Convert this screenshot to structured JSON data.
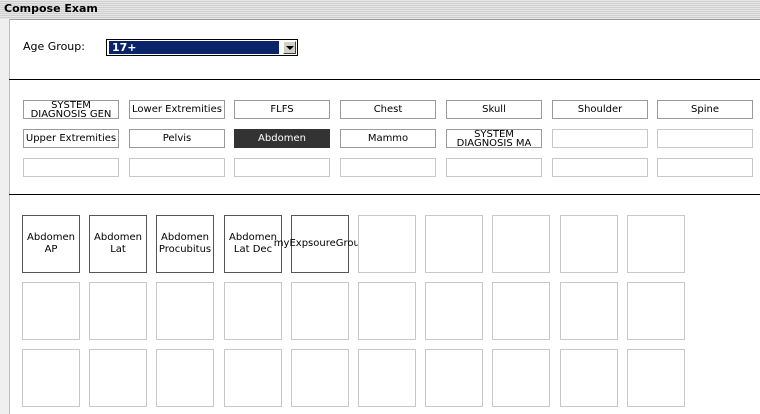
{
  "window": {
    "title": "Compose Exam"
  },
  "age_group": {
    "label": "Age Group:",
    "selected": "17+"
  },
  "categories": [
    [
      "SYSTEM DIAGNOSIS GEN",
      "Lower Extremities",
      "FLFS",
      "Chest",
      "Skull",
      "Shoulder",
      "Spine"
    ],
    [
      "Upper Extremities",
      "Pelvis",
      "Abdomen",
      "Mammo",
      "SYSTEM DIAGNOSIS MA",
      "",
      ""
    ],
    [
      "",
      "",
      "",
      "",
      "",
      "",
      ""
    ]
  ],
  "active_category": "Abdomen",
  "exposures": [
    [
      "Abdomen AP",
      "Abdomen Lat",
      "Abdomen Procubitus",
      "Abdomen Lat Dec",
      "myExpsoureGroup",
      "",
      "",
      "",
      "",
      ""
    ],
    [
      "",
      "",
      "",
      "",
      "",
      "",
      "",
      "",
      "",
      ""
    ],
    [
      "",
      "",
      "",
      "",
      "",
      "",
      "",
      "",
      "",
      ""
    ]
  ]
}
